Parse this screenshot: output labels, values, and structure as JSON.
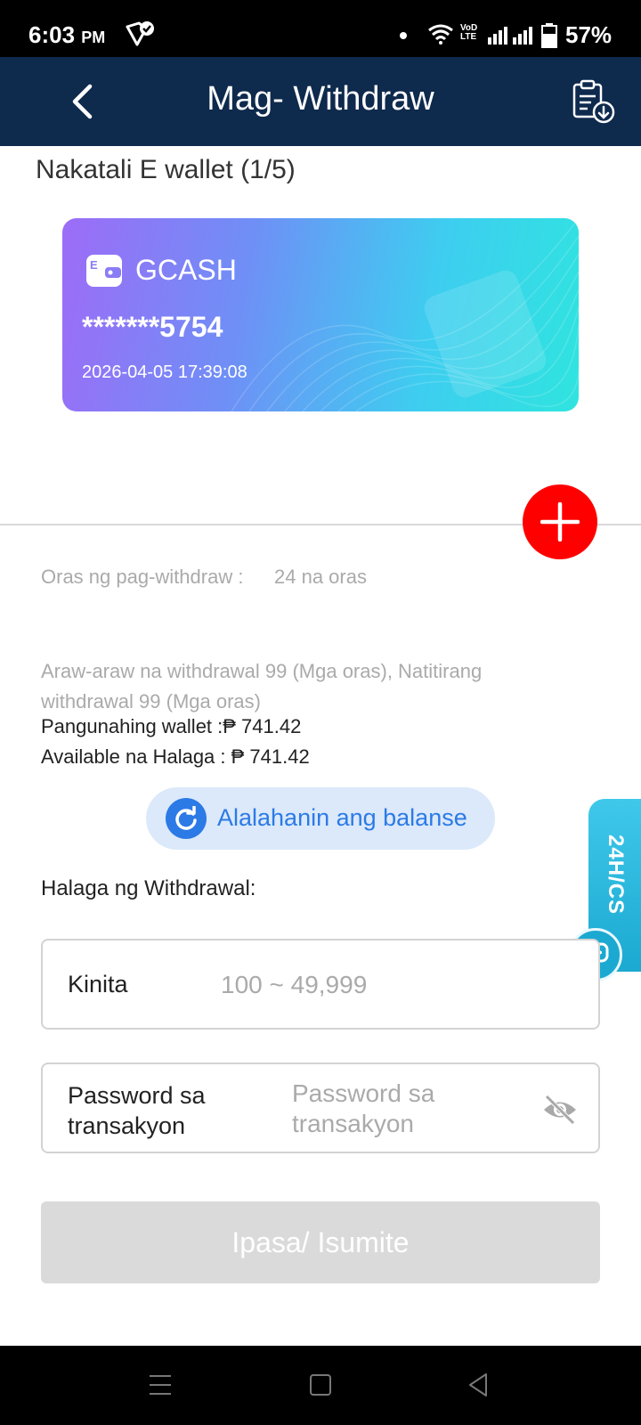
{
  "status_bar": {
    "time": "6:03",
    "ampm": "PM",
    "network_label": "VoD LTE",
    "battery": "57%"
  },
  "header": {
    "title": "Mag- Withdraw"
  },
  "wallet_section": {
    "title": "Nakatali E wallet (1/5)",
    "card": {
      "brand": "GCASH",
      "number": "*******5754",
      "date": "2026-04-05 17:39:08",
      "gradient_start": "#9d6cf7",
      "gradient_end": "#2fe4df"
    }
  },
  "info": {
    "time_label": "Oras ng pag-withdraw :",
    "time_value": "24 na oras",
    "daily": "Araw-araw na withdrawal 99 (Mga oras), Natitirang withdrawal 99 (Mga oras)",
    "main_wallet": "Pangunahing wallet :₱ 741.42",
    "available": "Available na Halaga : ₱ 741.42"
  },
  "recall_button": {
    "label": "Alalahanin ang balanse"
  },
  "customer_service": {
    "label": "24H/CS"
  },
  "form": {
    "amount_title": "Halaga ng Withdrawal:",
    "amount_label": "Kinita",
    "amount_placeholder": "100 ~ 49,999",
    "password_label": "Password sa transakyon",
    "password_placeholder": "Password sa transakyon"
  },
  "submit": {
    "label": "Ipasa/ Isumite"
  },
  "colors": {
    "header_bg": "#0e2a4d",
    "add_button": "#ff0000",
    "accent_blue": "#2c7ae6",
    "cs_tab": "#1ba9d1"
  }
}
